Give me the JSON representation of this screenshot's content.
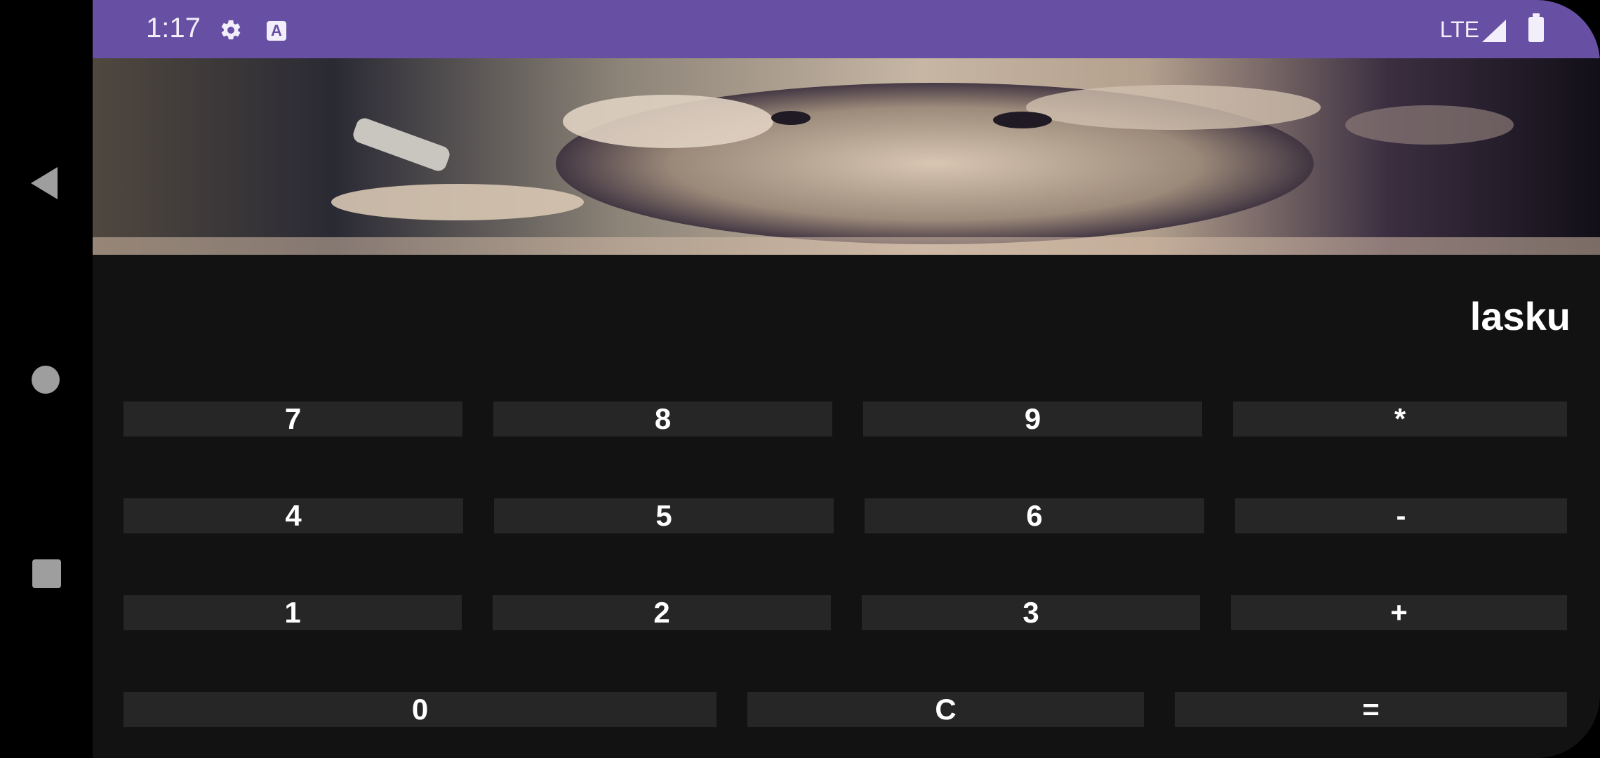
{
  "status_bar": {
    "time": "1:17",
    "network": "LTE",
    "icons": [
      "gear-icon",
      "text-a-icon",
      "signal-icon",
      "battery-icon"
    ],
    "color": "#6750a4"
  },
  "navigation": {
    "icons": [
      "back-triangle-icon",
      "home-circle-icon",
      "recents-square-icon"
    ]
  },
  "hero_image": {
    "description_icon": "artwork-image"
  },
  "calculator": {
    "display": "lasku",
    "rows": [
      [
        "7",
        "8",
        "9",
        "*"
      ],
      [
        "4",
        "5",
        "6",
        "-"
      ],
      [
        "1",
        "2",
        "3",
        "+"
      ],
      [
        "0",
        "C",
        "="
      ]
    ],
    "colors": {
      "background": "#121212",
      "button": "#262626",
      "text": "#ffffff"
    }
  }
}
